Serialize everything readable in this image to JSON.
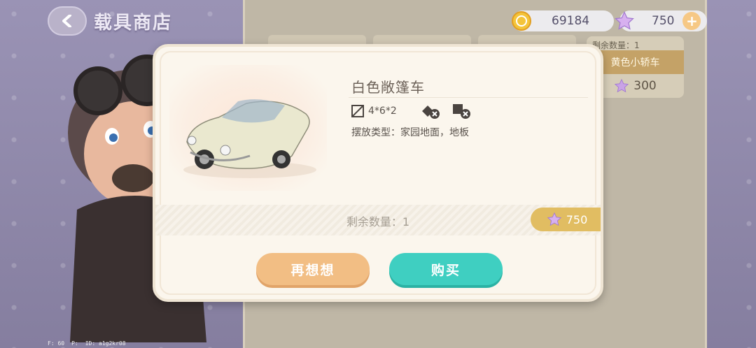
{
  "header": {
    "title": "载具商店"
  },
  "currency": {
    "gold": "69184",
    "stars": "750",
    "plus": "+"
  },
  "background_card": {
    "remain": "剩余数量：1",
    "name": "黄色小轿车",
    "price": "300"
  },
  "modal": {
    "item_name": "白色敞篷车",
    "size": "4*6*2",
    "placement": "摆放类型：家园地面，地板",
    "remaining": "剩余数量：1",
    "price": "750",
    "cancel_label": "再想想",
    "buy_label": "购买"
  },
  "debug": {
    "fps": "F: 60",
    "p": "P:",
    "id": "ID: a1g2kr08"
  },
  "colors": {
    "gold": "#f0b93a",
    "star": "#c9a3e6",
    "teal": "#3fcfc1",
    "orange": "#f2be84"
  },
  "icons": [
    "back-arrow-icon",
    "gold-coin-icon",
    "star-icon",
    "plus-icon",
    "size-icon",
    "no-rotate-icon",
    "no-stack-icon",
    "car-image"
  ]
}
